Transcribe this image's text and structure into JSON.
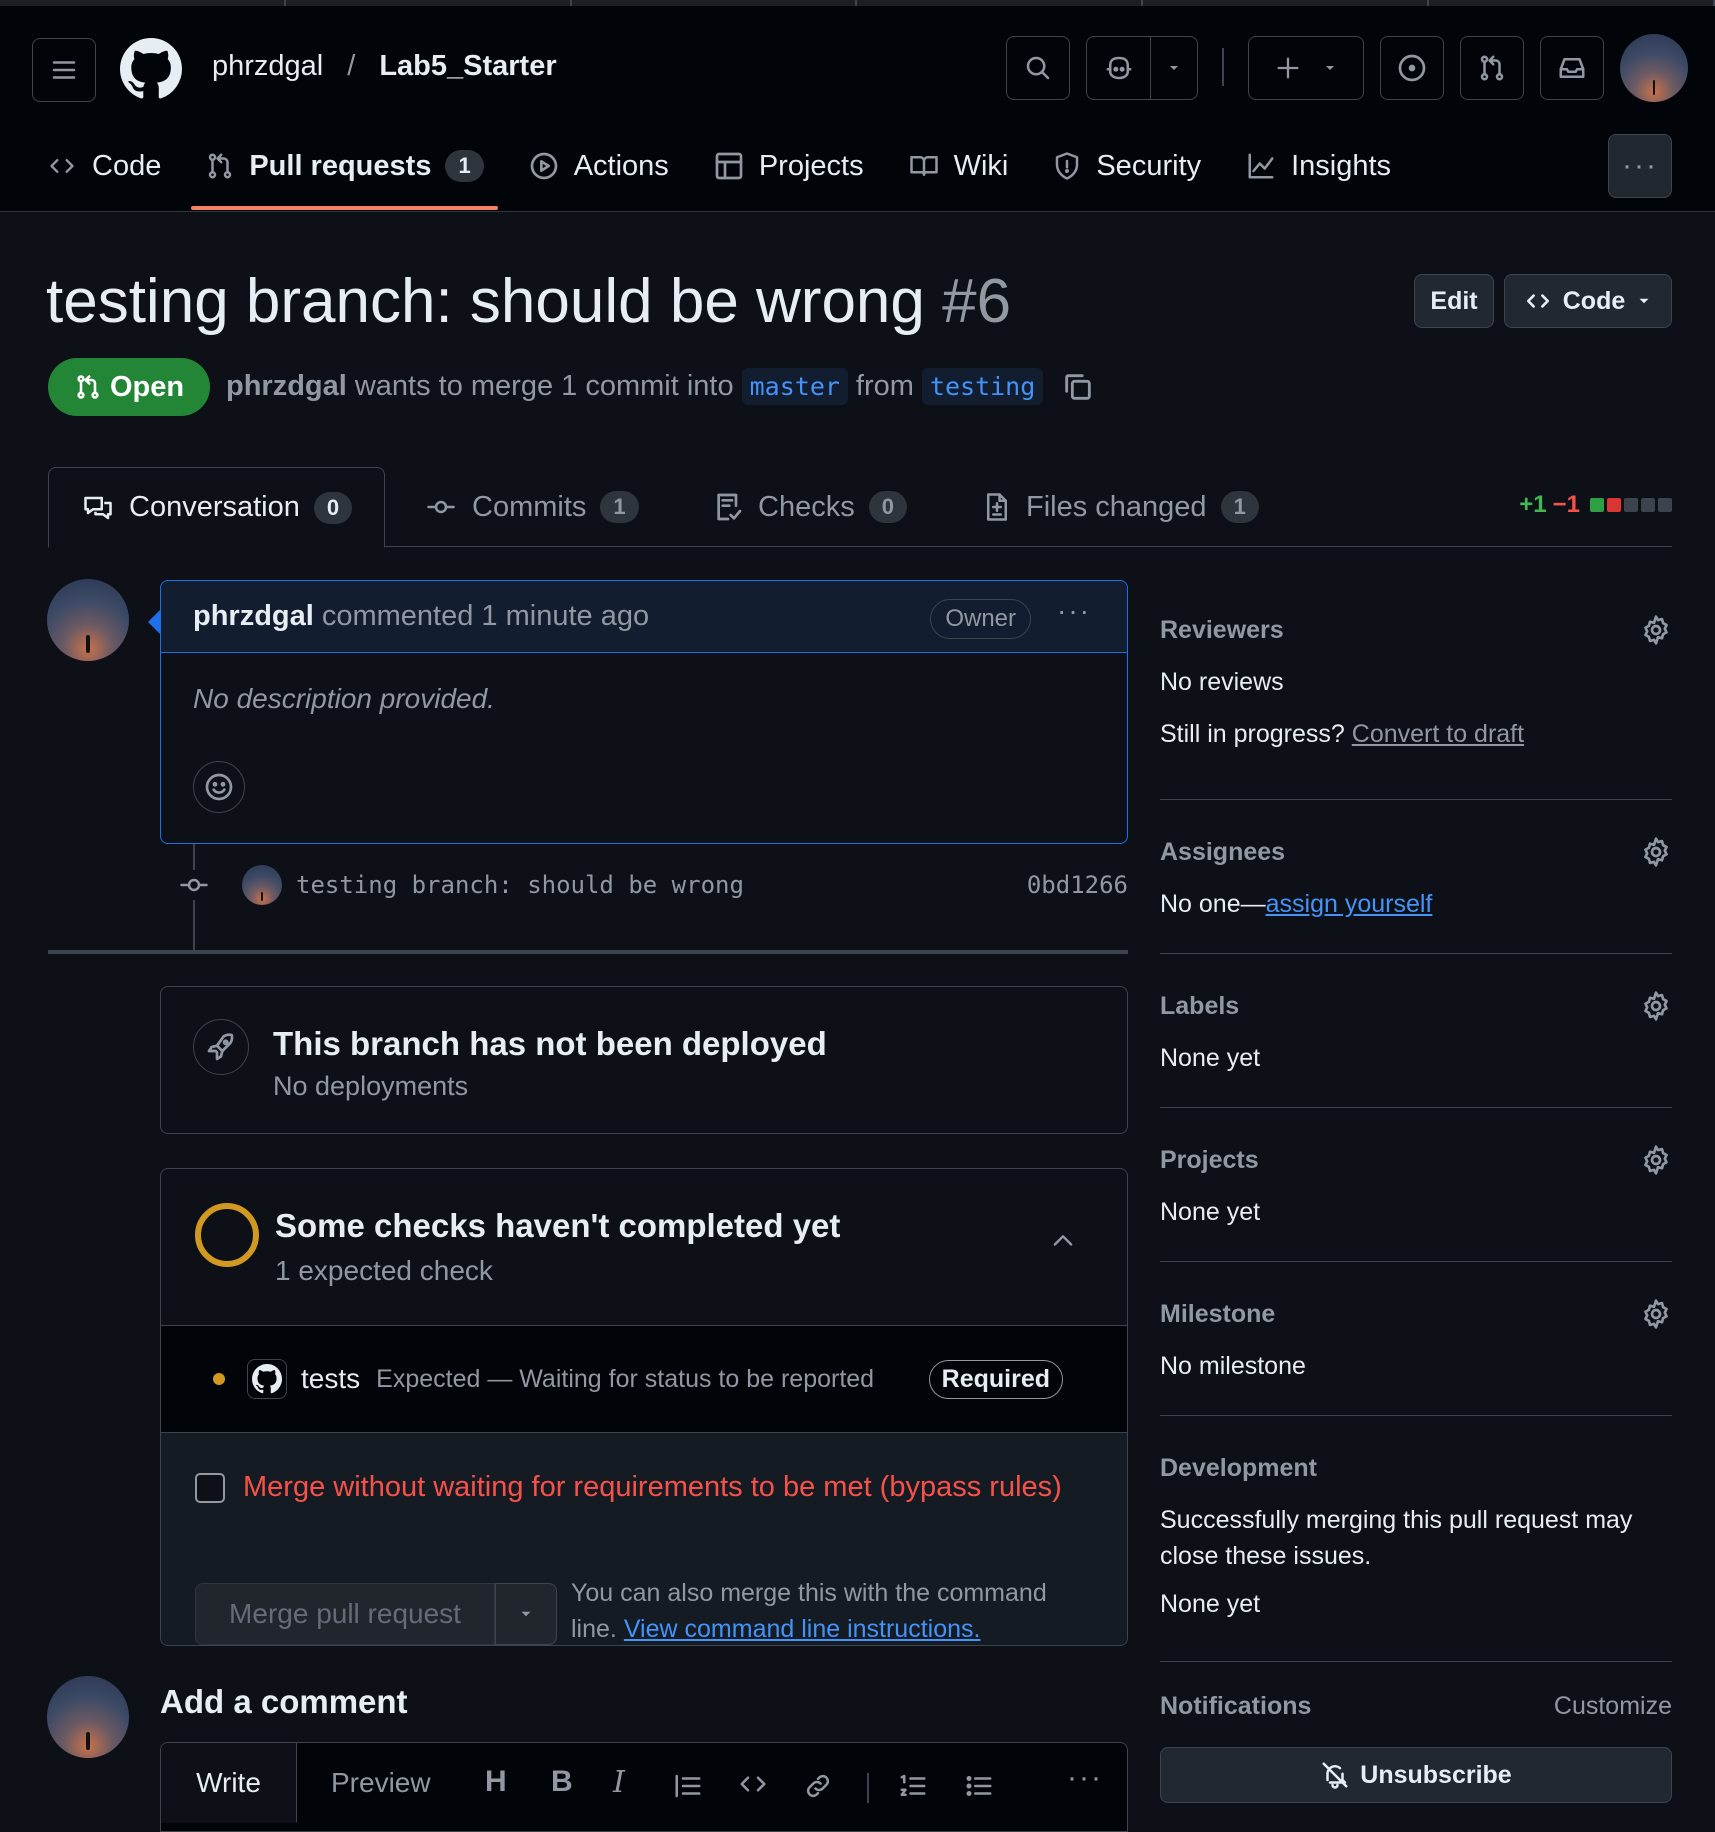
{
  "header": {
    "owner": "phrzdgal",
    "separator": "/",
    "repo": "Lab5_Starter"
  },
  "nav": {
    "code": "Code",
    "pull_requests": "Pull requests",
    "pull_requests_count": "1",
    "actions": "Actions",
    "projects": "Projects",
    "wiki": "Wiki",
    "security": "Security",
    "insights": "Insights"
  },
  "pr": {
    "title": "testing branch: should be wrong",
    "number": "#6",
    "edit_label": "Edit",
    "code_label": "Code",
    "state": "Open",
    "author": "phrzdgal",
    "merge_text": "wants to merge 1 commit into",
    "base_branch": "master",
    "from_text": "from",
    "head_branch": "testing"
  },
  "pr_tabs": {
    "conversation": "Conversation",
    "conversation_count": "0",
    "commits": "Commits",
    "commits_count": "1",
    "checks": "Checks",
    "checks_count": "0",
    "files_changed": "Files changed",
    "files_changed_count": "1",
    "additions": "+1",
    "deletions": "−1"
  },
  "comment": {
    "author": "phrzdgal",
    "action": "commented 1 minute ago",
    "badge": "Owner",
    "body": "No description provided."
  },
  "commit": {
    "message": "testing branch: should be wrong",
    "sha": "0bd1266"
  },
  "deployment": {
    "title": "This branch has not been deployed",
    "subtitle": "No deployments"
  },
  "checks": {
    "title": "Some checks haven't completed yet",
    "subtitle": "1 expected check",
    "check_name": "tests",
    "check_status": "Expected — Waiting for status to be reported",
    "required": "Required",
    "bypass_label": "Merge without waiting for requirements to be met (bypass rules)",
    "merge_button": "Merge pull request",
    "cli_text": "You can also merge this with the command line.",
    "cli_link": "View command line instructions."
  },
  "add_comment": {
    "title": "Add a comment",
    "write_tab": "Write",
    "preview_tab": "Preview"
  },
  "sidebar": {
    "reviewers_title": "Reviewers",
    "reviewers_value": "No reviews",
    "in_progress": "Still in progress?",
    "convert_draft": "Convert to draft",
    "assignees_title": "Assignees",
    "assignees_prefix": "No one—",
    "assign_yourself": "assign yourself",
    "labels_title": "Labels",
    "labels_value": "None yet",
    "projects_title": "Projects",
    "projects_value": "None yet",
    "milestone_title": "Milestone",
    "milestone_value": "No milestone",
    "development_title": "Development",
    "development_text": "Successfully merging this pull request may close these issues.",
    "development_value": "None yet",
    "notifications_title": "Notifications",
    "customize": "Customize",
    "unsubscribe": "Unsubscribe"
  },
  "colors": {
    "open_green": "#238636",
    "accent_blue": "#4493f8",
    "warning_yellow": "#d29922",
    "danger_red": "#f85149",
    "underline_orange": "#f78166"
  }
}
